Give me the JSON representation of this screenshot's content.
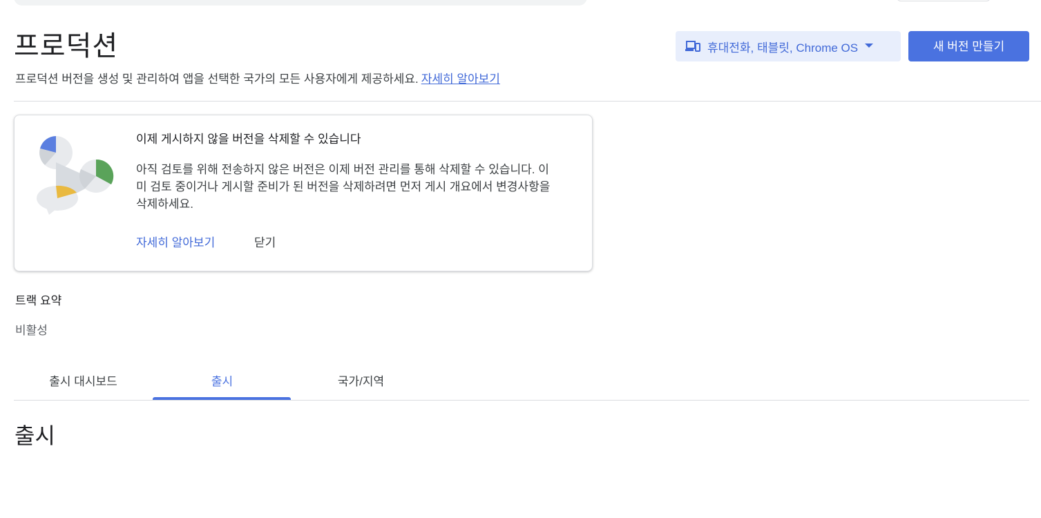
{
  "header": {
    "title": "프로덕션",
    "subtitle": "프로덕션 버전을 생성 및 관리하여 앱을 선택한 국가의 모든 사용자에게 제공하세요.",
    "learn_more": "자세히 알아보기",
    "device_selector": {
      "label": "휴대전화, 태블릿, Chrome OS",
      "icon": "devices-icon"
    },
    "create_release": "새 버전 만들기"
  },
  "notice": {
    "title": "이제 게시하지 않을 버전을 삭제할 수 있습니다",
    "body": "아직 검토를 위해 전송하지 않은 버전은 이제 버전 관리를 통해 삭제할 수 있습니다. 이미 검토 중이거나 게시할 준비가 된 버전을 삭제하려면 먼저 게시 개요에서 변경사항을 삭제하세요.",
    "learn_more": "자세히 알아보기",
    "dismiss": "닫기"
  },
  "track": {
    "label": "트랙 요약",
    "status": "비활성"
  },
  "tabs": [
    {
      "label": "출시 대시보드",
      "active": false
    },
    {
      "label": "출시",
      "active": true
    },
    {
      "label": "국가/지역",
      "active": false
    }
  ],
  "section": {
    "title": "출시"
  },
  "colors": {
    "accent": "#4a72e0",
    "link": "#4169d8",
    "selector_bg": "#e8eefc"
  }
}
